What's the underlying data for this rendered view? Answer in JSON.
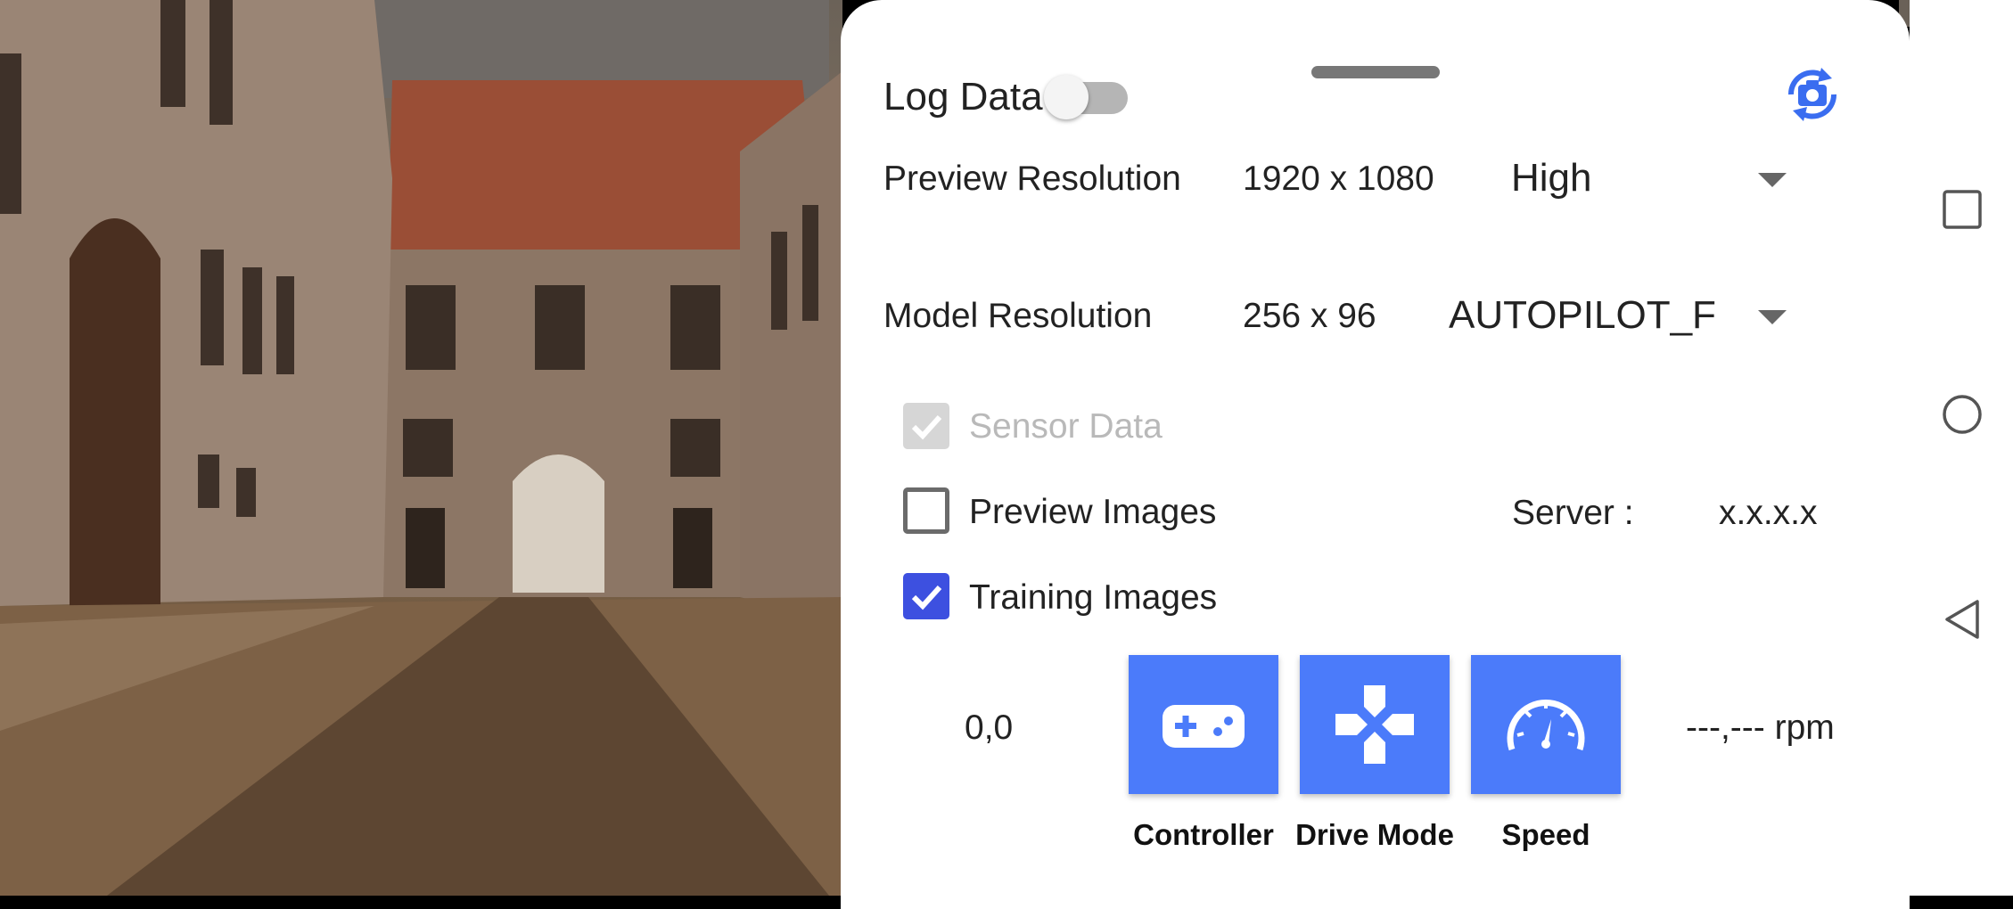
{
  "log_data": {
    "label": "Log Data",
    "enabled": false
  },
  "preview_resolution": {
    "label": "Preview Resolution",
    "value": "1920 x 1080",
    "selected": "High"
  },
  "model_resolution": {
    "label": "Model Resolution",
    "value": "256 x 96",
    "selected": "AUTOPILOT_F"
  },
  "options": {
    "sensor_data": {
      "label": "Sensor Data",
      "checked": true,
      "disabled": true
    },
    "preview_images": {
      "label": "Preview Images",
      "checked": false
    },
    "training_images": {
      "label": "Training Images",
      "checked": true
    }
  },
  "server": {
    "label": "Server :",
    "value": "x.x.x.x"
  },
  "control": {
    "value": "0,0"
  },
  "rpm": {
    "value": "---,--- rpm"
  },
  "tiles": {
    "controller": {
      "label": "Controller",
      "icon": "gamepad-icon"
    },
    "drive_mode": {
      "label": "Drive Mode",
      "icon": "dpad-icon"
    },
    "speed": {
      "label": "Speed",
      "icon": "speedometer-icon"
    }
  },
  "colors": {
    "accent": "#4b7bfa",
    "checkbox": "#3d50e0",
    "switch_camera": "#3a6df0"
  },
  "nav": {
    "icons": [
      "square-icon",
      "circle-icon",
      "triangle-back-icon"
    ]
  }
}
